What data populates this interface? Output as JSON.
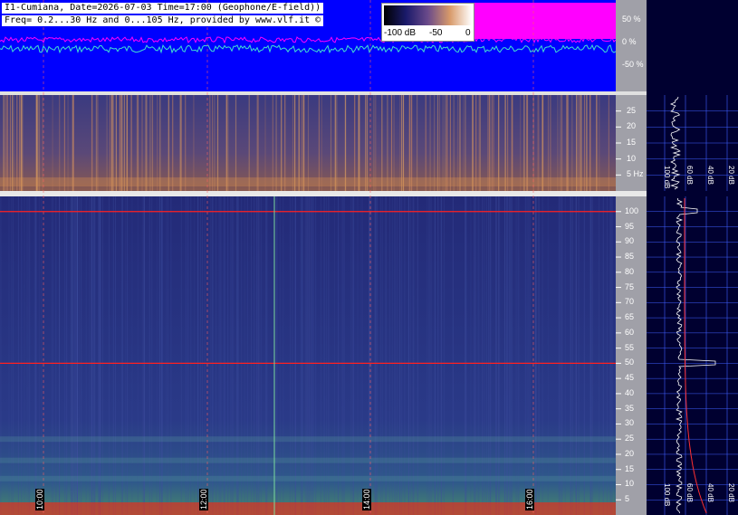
{
  "header": {
    "line1": "I1-Cumiana, Date=2026-07-03 Time=17:00 (Geophone/E-field))",
    "line2": "Freq= 0.2...30 Hz and 0...105 Hz, provided by www.vlf.it ©"
  },
  "colorbar": {
    "labels": [
      "-100 dB",
      "-50",
      "0"
    ]
  },
  "colors": {
    "top_bg": "#0000ff",
    "magenta": "#ff00ff",
    "cyan": "#40e0d0",
    "gray_axis": "#a0a0a8",
    "spec_bg": "#2a2e78",
    "marker_red": "#ff2020",
    "grid_blue": "#4060ff"
  },
  "chart_data": [
    {
      "type": "line",
      "panel": "amplitude",
      "ylabels": [
        "50 %",
        "0 %",
        "-50 %"
      ],
      "yticks": [
        50,
        0,
        -50
      ]
    },
    {
      "type": "heatmap",
      "panel": "spectrogram-low",
      "ylabels": [
        "25",
        "20",
        "15",
        "10",
        "5 Hz"
      ],
      "yticks": [
        25,
        20,
        15,
        10,
        5
      ],
      "ylim": [
        0.2,
        30
      ]
    },
    {
      "type": "heatmap",
      "panel": "spectrogram-high",
      "ylabels": [
        "100",
        "95",
        "90",
        "85",
        "80",
        "75",
        "70",
        "65",
        "60",
        "55",
        "50",
        "45",
        "40",
        "35",
        "30",
        "25",
        "20",
        "15",
        "10",
        "5"
      ],
      "yticks": [
        100,
        95,
        90,
        85,
        80,
        75,
        70,
        65,
        60,
        55,
        50,
        45,
        40,
        35,
        30,
        25,
        20,
        15,
        10,
        5
      ],
      "ylim": [
        0,
        105
      ],
      "time_labels": [
        "10:00",
        "12:00",
        "14:00",
        "16:00"
      ]
    },
    {
      "type": "line",
      "panel": "spectrum-profile",
      "xlabels_top": [
        "100 dB",
        "60 dB",
        "40 dB",
        "20 dB"
      ],
      "xlabels_bottom": [
        "100 dB",
        "60 dB",
        "40 dB",
        "20 dB"
      ]
    }
  ]
}
